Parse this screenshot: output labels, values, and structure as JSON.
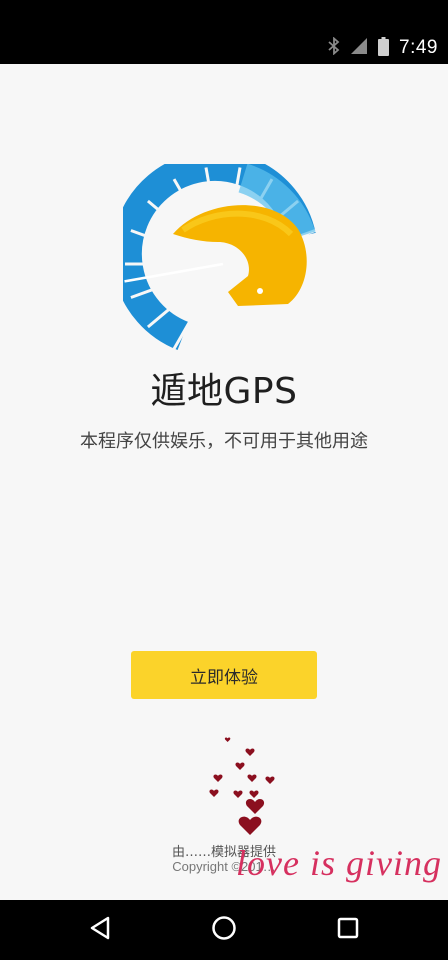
{
  "status_bar": {
    "time": "7:49",
    "icons": [
      "bluetooth-icon",
      "signal-icon",
      "battery-icon"
    ]
  },
  "app": {
    "title": "遁地GPS",
    "subtitle": "本程序仅供娱乐，不可用于其他用途",
    "cta_label": "立即体验"
  },
  "footer": {
    "line1": "由……模拟器提供",
    "line2": "Copyright ©201…"
  },
  "watermark": {
    "text": "love is giving"
  },
  "nav_bar": {
    "buttons": [
      "back-icon",
      "home-icon",
      "recents-icon"
    ]
  },
  "colors": {
    "accent": "#fbd32a",
    "logo_blue": "#1e8fd6",
    "logo_yellow": "#f6b400",
    "watermark": "#d6305f",
    "heart": "#8b0f1f"
  }
}
